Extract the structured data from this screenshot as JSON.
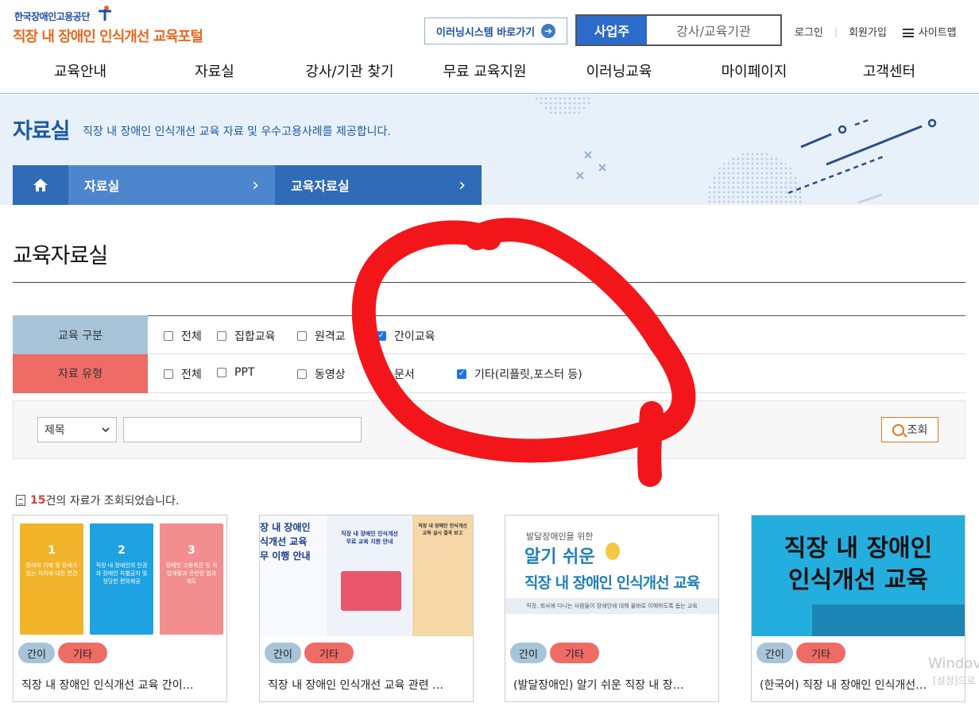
{
  "header": {
    "org_name": "한국장애인고용공단",
    "portal_title": "직장 내 장애인 인식개선 교육포털",
    "elearning_button": "이러닝시스템 바로가기",
    "user_tabs": [
      {
        "label": "사업주",
        "active": true
      },
      {
        "label": "강사/교육기관",
        "active": false
      }
    ],
    "login": "로그인",
    "signup": "회원가입",
    "sitemap": "사이트맵",
    "brand_color": "#1f4ea3",
    "accent_color": "#e8681e"
  },
  "nav": [
    "교육안내",
    "자료실",
    "강사/기관 찾기",
    "무료 교육지원",
    "이러닝교육",
    "마이페이지",
    "고객센터"
  ],
  "visual": {
    "title": "자료실",
    "description": "직장 내 장애인 인식개선 교육 자료 및 우수고용사례를 제공합니다."
  },
  "breadcrumb": {
    "home_icon": "home-icon",
    "level1": "자료실",
    "level2": "교육자료실"
  },
  "page_title": "교육자료실",
  "filters": [
    {
      "label": "교육 구분",
      "label_bg": "#a7c4d8",
      "options": [
        {
          "text": "전체",
          "checked": false
        },
        {
          "text": "집합교육",
          "checked": false
        },
        {
          "text": "원격교",
          "checked": false
        },
        {
          "text": "간이교육",
          "checked": true
        }
      ]
    },
    {
      "label": "자료 유형",
      "label_bg": "#ef6b65",
      "options": [
        {
          "text": "전체",
          "checked": false
        },
        {
          "text": "PPT",
          "checked": false
        },
        {
          "text": "동영상",
          "checked": false
        },
        {
          "text": "문서",
          "checked": false
        },
        {
          "text": "기타(리플릿,포스터 등)",
          "checked": true
        }
      ]
    }
  ],
  "search": {
    "select_value": "제목",
    "input_value": "",
    "button": "조회"
  },
  "result": {
    "count": "15",
    "suffix": "건의 자료가 조회되었습니다."
  },
  "cards": [
    {
      "title": "직장 내 장애인 인식개선 교육 간이…",
      "tags": [
        "간이",
        "기타"
      ],
      "thumb": {
        "books": [
          {
            "num": "1",
            "text": "장애의 이해 및 장애가 있는 지이에 대한 편견"
          },
          {
            "num": "2",
            "text": "직장 내 장애인의 인권과 장애인 차별금지 및 정당한 편의제공"
          },
          {
            "num": "3",
            "text": "장애인 고용촉진 및 직업재활과 관련된 법과 제도"
          }
        ]
      }
    },
    {
      "title": "직장 내 장애인 인식개선 교육 관련 …",
      "tags": [
        "간이",
        "기타"
      ],
      "thumb": {
        "left": "장 내 장애인\n식개선 교육\n무 이행 안내",
        "center": "직장 내 장애인 인식개선\n무료 교육 지원 안내",
        "right": "직장 내 장애인 인식개선\n교육 실시 결과 보고"
      }
    },
    {
      "title": "(발달장애인) 알기 쉬운 직장 내 장…",
      "tags": [
        "간이",
        "기타"
      ],
      "thumb": {
        "small": "발달장애인을 위한",
        "big1": "알기 쉬운",
        "big2": "직장 내 장애인 인식개선 교육",
        "caption": "직장, 회사에 다니는 사람들이 장애인에 대해 올바로 이해하도록 돕는 교육"
      }
    },
    {
      "title": "(한국어) 직장 내 장애인 인식개선…",
      "tags": [
        "간이",
        "기타"
      ],
      "thumb": {
        "line1": "직장 내 장애인",
        "line2": "인식개선 교육"
      }
    }
  ],
  "watermark": {
    "line1": "Windov",
    "line2": "[설정]으로"
  }
}
